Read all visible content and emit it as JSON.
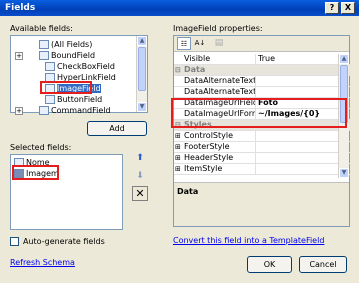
{
  "window": {
    "title": "Fields",
    "help_label": "?",
    "close_label": "X"
  },
  "available_fields": {
    "label": "Available fields:",
    "items": [
      {
        "label": "(All Fields)",
        "expander": ""
      },
      {
        "label": "BoundField",
        "expander": "+"
      },
      {
        "label": "CheckBoxField",
        "expander": ""
      },
      {
        "label": "HyperLinkField",
        "expander": ""
      },
      {
        "label": "ImageField",
        "expander": ""
      },
      {
        "label": "ButtonField",
        "expander": ""
      },
      {
        "label": "CommandField",
        "expander": "+"
      }
    ],
    "add_button": "Add"
  },
  "selected_fields": {
    "label": "Selected fields:",
    "items": [
      {
        "label": "Nome"
      },
      {
        "label": "Imagem"
      }
    ]
  },
  "auto_generate": {
    "label": "Auto-generate fields",
    "checked": false
  },
  "refresh_link": "Refresh Schema",
  "properties": {
    "label": "ImageField properties:",
    "rows": [
      {
        "type": "prop",
        "name": "Visible",
        "value": "True"
      },
      {
        "type": "cat",
        "name": "Data",
        "expander": "⊟"
      },
      {
        "type": "prop",
        "name": "DataAlternateTextFi",
        "value": ""
      },
      {
        "type": "prop",
        "name": "DataAlternateTextFi",
        "value": ""
      },
      {
        "type": "prop",
        "name": "DataImageUrlField",
        "value": "Foto",
        "bold": true
      },
      {
        "type": "prop",
        "name": "DataImageUrlFormat",
        "value": "~/Images/{0}",
        "bold": true
      },
      {
        "type": "cat",
        "name": "Styles",
        "expander": "⊟"
      },
      {
        "type": "prop",
        "name": "ControlStyle",
        "value": "",
        "expander": "⊞"
      },
      {
        "type": "prop",
        "name": "FooterStyle",
        "value": "",
        "expander": "⊞"
      },
      {
        "type": "prop",
        "name": "HeaderStyle",
        "value": "",
        "expander": "⊞"
      },
      {
        "type": "prop",
        "name": "ItemStyle",
        "value": "",
        "expander": "⊞"
      }
    ],
    "description_title": "Data"
  },
  "convert_link": "Convert this field into a TemplateField",
  "ok_button": "OK",
  "cancel_button": "Cancel",
  "colors": {
    "highlight_red": "#e51d1d",
    "link": "#0000ee",
    "title_blue": "#0a4ecb"
  }
}
